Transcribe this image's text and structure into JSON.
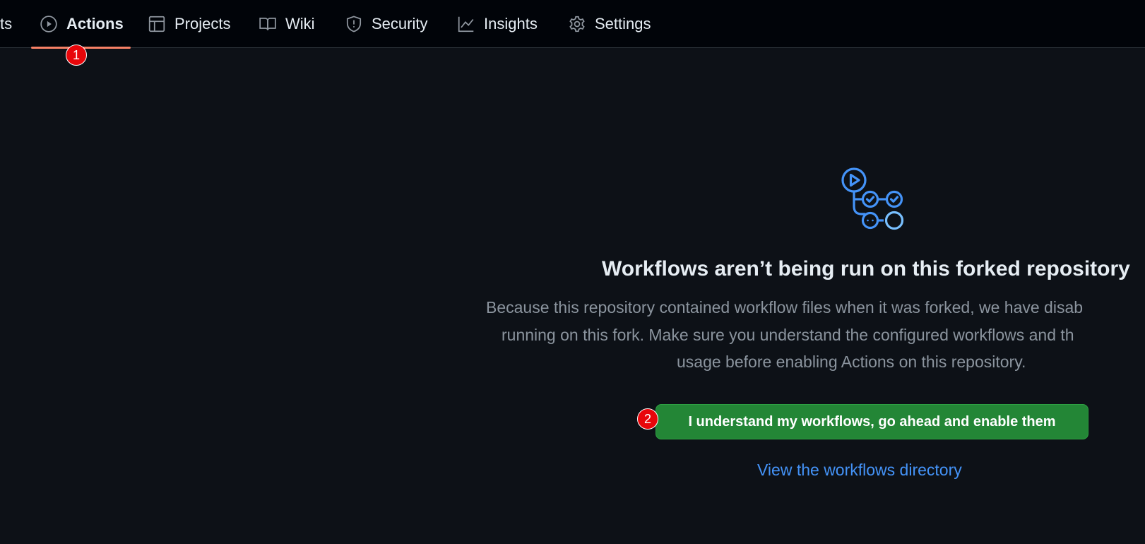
{
  "nav": {
    "tabs": [
      {
        "label": "ts",
        "icon": "none"
      },
      {
        "label": "Actions",
        "icon": "play-icon",
        "active": true
      },
      {
        "label": "Projects",
        "icon": "table-icon"
      },
      {
        "label": "Wiki",
        "icon": "book-icon"
      },
      {
        "label": "Security",
        "icon": "shield-icon"
      },
      {
        "label": "Insights",
        "icon": "graph-icon"
      },
      {
        "label": "Settings",
        "icon": "gear-icon"
      }
    ]
  },
  "markers": {
    "first": "1",
    "second": "2"
  },
  "main": {
    "icon": "workflow-icon",
    "title": "Workflows aren’t being run on this forked repository",
    "description_lines": [
      "Because this repository contained workflow files when it was forked, we have disab",
      "running on this fork. Make sure you understand the configured workflows and th",
      "usage before enabling Actions on this repository."
    ],
    "enable_button": "I understand my workflows, go ahead and enable them",
    "view_link": "View the workflows directory"
  },
  "colors": {
    "background": "#0d1117",
    "nav_background": "#010409",
    "accent_underline": "#f78166",
    "button_green": "#238636",
    "link_blue": "#4493f8",
    "marker_red": "#e8060a"
  }
}
